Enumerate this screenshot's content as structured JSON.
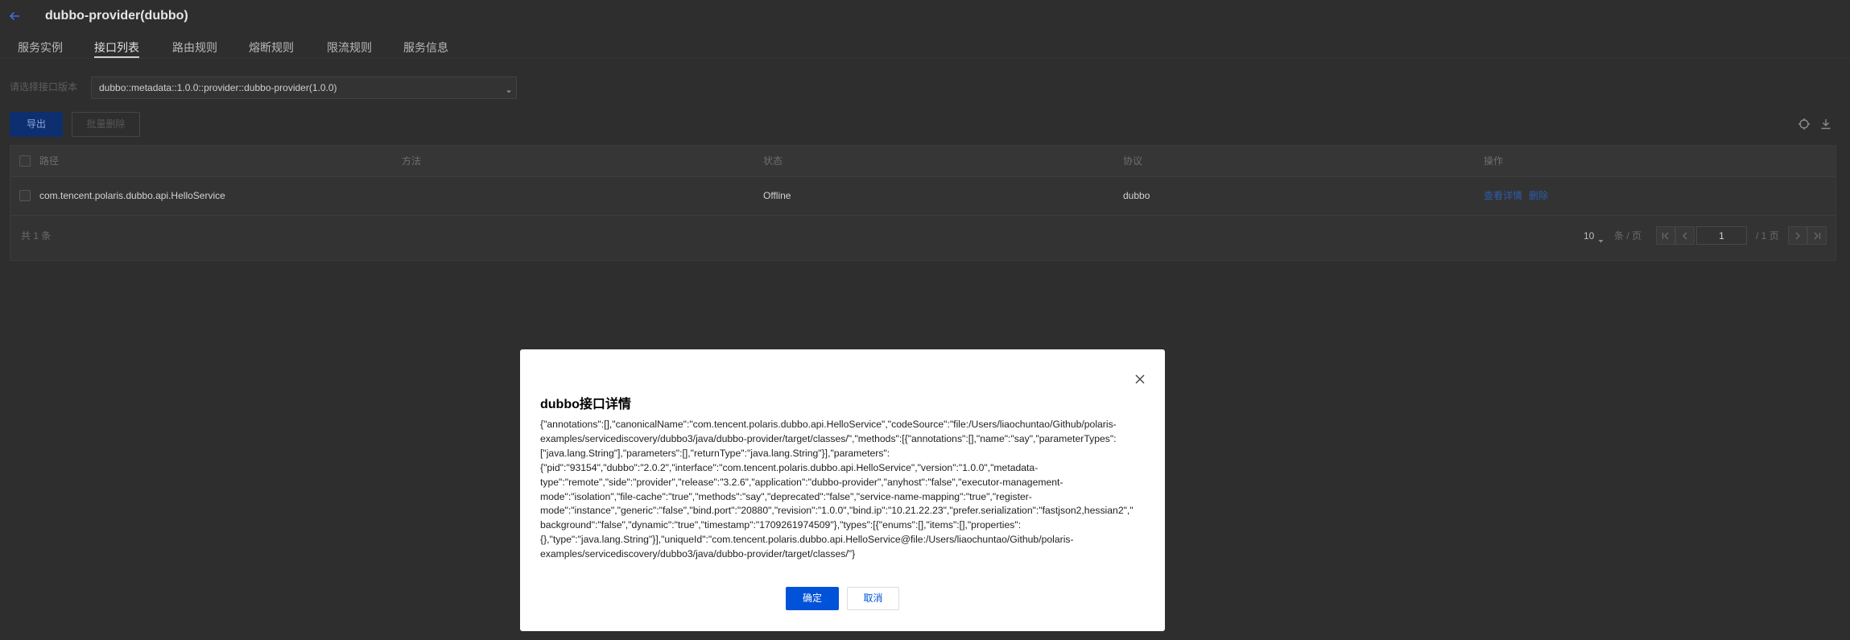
{
  "header": {
    "title": "dubbo-provider(dubbo)"
  },
  "tabs": [
    {
      "label": "服务实例"
    },
    {
      "label": "接口列表",
      "active": true
    },
    {
      "label": "路由规则"
    },
    {
      "label": "熔断规则"
    },
    {
      "label": "限流规则"
    },
    {
      "label": "服务信息"
    }
  ],
  "filter": {
    "label": "请选择接口版本",
    "selected": "dubbo::metadata::1.0.0::provider::dubbo-provider(1.0.0)"
  },
  "toolbar": {
    "export_label": "导出",
    "batch_delete_label": "批量删除"
  },
  "table": {
    "columns": [
      "路径",
      "方法",
      "状态",
      "协议",
      "操作"
    ],
    "rows": [
      {
        "path": "com.tencent.polaris.dubbo.api.HelloService",
        "status": "Offline",
        "protocol": "dubbo",
        "actions": [
          "查看详情",
          "删除"
        ]
      }
    ]
  },
  "pagination": {
    "total_text": "共 1 条",
    "page_size": "10",
    "page_size_unit": "条 / 页",
    "current_page": "1",
    "total_pages_text": "/ 1 页"
  },
  "modal": {
    "title": "dubbo接口详情",
    "detail_lines": [
      "{\"annotations\":[],\"canonicalName\":\"com.tencent.polaris.dubbo.api.HelloService\",\"codeSource\":\"file:/Users/liaochuntao/Github/polaris-",
      "examples/servicediscovery/dubbo3/java/dubbo-provider/target/classes/\",\"methods\":[{\"annotations\":[],\"name\":\"say\",\"parameterTypes\":",
      "[\"java.lang.String\"],\"parameters\":[],\"returnType\":\"java.lang.String\"}],\"parameters\":",
      "{\"pid\":\"93154\",\"dubbo\":\"2.0.2\",\"interface\":\"com.tencent.polaris.dubbo.api.HelloService\",\"version\":\"1.0.0\",\"metadata-",
      "type\":\"remote\",\"side\":\"provider\",\"release\":\"3.2.6\",\"application\":\"dubbo-provider\",\"anyhost\":\"false\",\"executor-management-",
      "mode\":\"isolation\",\"file-cache\":\"true\",\"methods\":\"say\",\"deprecated\":\"false\",\"service-name-mapping\":\"true\",\"register-",
      "mode\":\"instance\",\"generic\":\"false\",\"bind.port\":\"20880\",\"revision\":\"1.0.0\",\"bind.ip\":\"10.21.22.23\",\"prefer.serialization\":\"fastjson2,hessian2\",\"",
      "background\":\"false\",\"dynamic\":\"true\",\"timestamp\":\"1709261974509\"},\"types\":[{\"enums\":[],\"items\":[],\"properties\":",
      "{},\"type\":\"java.lang.String\"}],\"uniqueId\":\"com.tencent.polaris.dubbo.api.HelloService@file:/Users/liaochuntao/Github/polaris-",
      "examples/servicediscovery/dubbo3/java/dubbo-provider/target/classes/\"}"
    ],
    "confirm_label": "确定",
    "cancel_label": "取消"
  },
  "colors": {
    "primary": "#0052d9",
    "page_bg": "#2e2e2e",
    "panel_bg": "#333333",
    "link": "#2d5cab"
  },
  "icons": {
    "back": "arrow-left-icon",
    "refresh": "refresh-icon",
    "download": "download-icon",
    "close": "close-icon",
    "select_caret": "chevron-down-icon"
  }
}
